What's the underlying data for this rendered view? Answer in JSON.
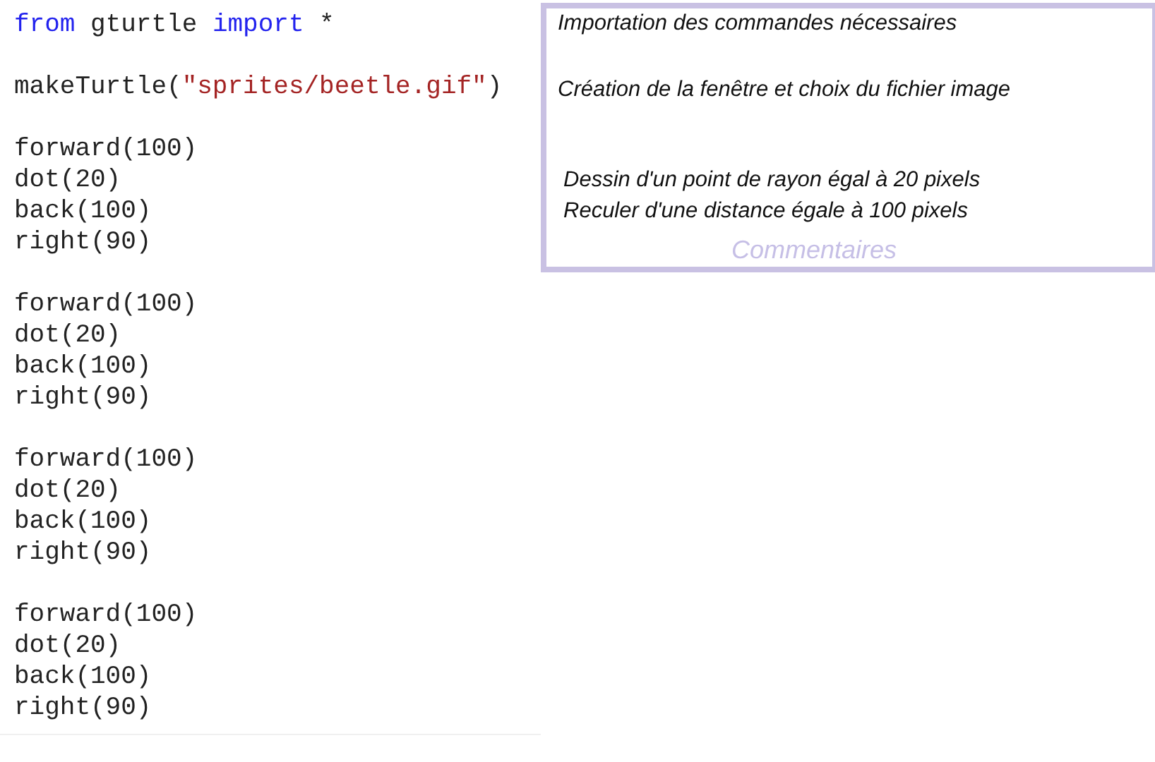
{
  "code_blocks": [
    [
      [
        {
          "kind": "keyword",
          "text": "from"
        },
        {
          "kind": "plain",
          "text": " gturtle "
        },
        {
          "kind": "keyword",
          "text": "import"
        },
        {
          "kind": "plain",
          "text": " *"
        }
      ]
    ],
    [
      [
        {
          "kind": "plain",
          "text": "makeTurtle("
        },
        {
          "kind": "string",
          "text": "\"sprites/beetle.gif\""
        },
        {
          "kind": "plain",
          "text": ")"
        }
      ]
    ],
    [
      [
        {
          "kind": "plain",
          "text": "forward(100)"
        }
      ],
      [
        {
          "kind": "plain",
          "text": "dot(20)"
        }
      ],
      [
        {
          "kind": "plain",
          "text": "back(100)"
        }
      ],
      [
        {
          "kind": "plain",
          "text": "right(90)"
        }
      ]
    ],
    [
      [
        {
          "kind": "plain",
          "text": "forward(100)"
        }
      ],
      [
        {
          "kind": "plain",
          "text": "dot(20)"
        }
      ],
      [
        {
          "kind": "plain",
          "text": "back(100)"
        }
      ],
      [
        {
          "kind": "plain",
          "text": "right(90)"
        }
      ]
    ],
    [
      [
        {
          "kind": "plain",
          "text": "forward(100)"
        }
      ],
      [
        {
          "kind": "plain",
          "text": "dot(20)"
        }
      ],
      [
        {
          "kind": "plain",
          "text": "back(100)"
        }
      ],
      [
        {
          "kind": "plain",
          "text": "right(90)"
        }
      ]
    ],
    [
      [
        {
          "kind": "plain",
          "text": "forward(100)"
        }
      ],
      [
        {
          "kind": "plain",
          "text": "dot(20)"
        }
      ],
      [
        {
          "kind": "plain",
          "text": "back(100)"
        }
      ],
      [
        {
          "kind": "plain",
          "text": "right(90)"
        }
      ]
    ]
  ],
  "comments_panel": {
    "comments": [
      "Importation des commandes nécessaires",
      "Création de la fenêtre et choix du fichier image",
      "Dessin d'un point de rayon égal à 20 pixels",
      "Reculer d'une distance égale à 100 pixels"
    ],
    "title": "Commentaires"
  }
}
